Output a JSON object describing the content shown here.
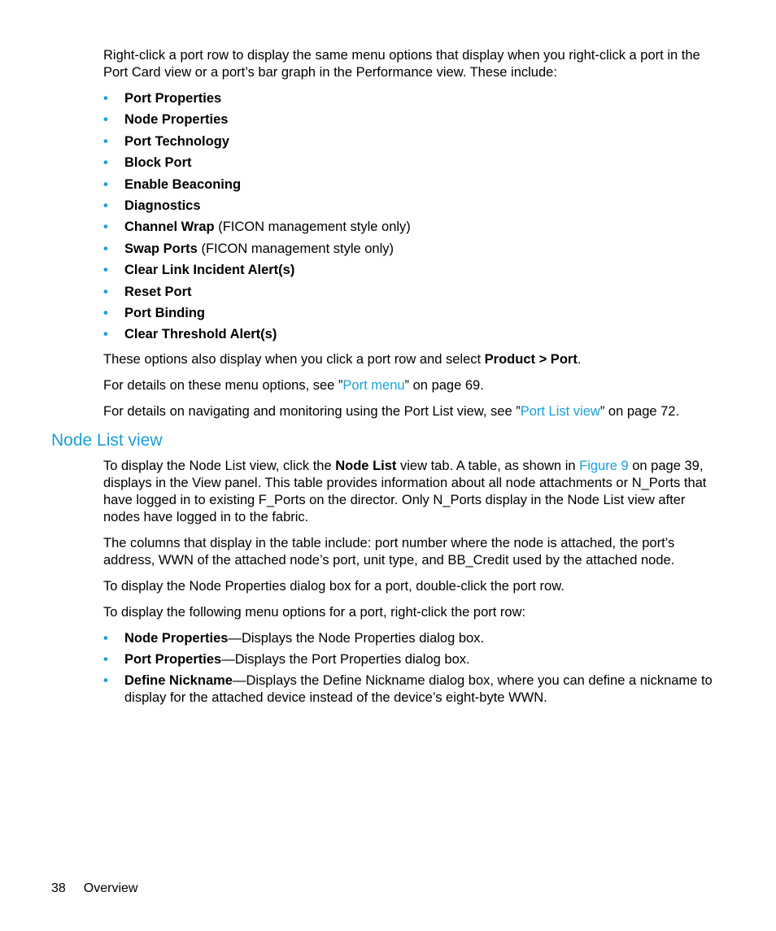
{
  "intro": "Right-click a port row to display the same menu options that display when you right-click a port in the Port Card view or a port’s bar graph in the Performance view. These include:",
  "port_menu_items": [
    {
      "bold": "Port Properties",
      "rest": ""
    },
    {
      "bold": "Node Properties",
      "rest": ""
    },
    {
      "bold": "Port Technology",
      "rest": ""
    },
    {
      "bold": "Block Port",
      "rest": ""
    },
    {
      "bold": "Enable Beaconing",
      "rest": ""
    },
    {
      "bold": "Diagnostics",
      "rest": ""
    },
    {
      "bold": "Channel Wrap",
      "rest": " (FICON management style only)"
    },
    {
      "bold": "Swap Ports",
      "rest": " (FICON management style only)"
    },
    {
      "bold": "Clear Link Incident Alert(s)",
      "rest": ""
    },
    {
      "bold": "Reset Port",
      "rest": ""
    },
    {
      "bold": "Port Binding",
      "rest": ""
    },
    {
      "bold": "Clear Threshold Alert(s)",
      "rest": ""
    }
  ],
  "also_display": {
    "pre": "These options also display when you click a port row and select ",
    "bold": "Product > Port",
    "post": "."
  },
  "details_menu": {
    "pre": "For details on these menu options, see ”",
    "link": "Port menu",
    "post": "” on page 69."
  },
  "details_portlist": {
    "pre": "For details on navigating and monitoring using the Port List view, see ”",
    "link": "Port List view",
    "post": "” on page 72."
  },
  "heading": "Node List view",
  "node_para1": {
    "pre": "To display the Node List view, click the ",
    "bold": "Node List",
    "mid": " view tab. A table, as shown in ",
    "link": "Figure 9",
    "post": " on page 39, displays in the View panel. This table provides information about all node attachments or N_Ports that have logged in to existing F_Ports on the director. Only N_Ports display in the Node List view after nodes have logged in to the fabric."
  },
  "node_para2": "The columns that display in the table include: port number where the node is attached, the port’s address, WWN of the attached node’s port, unit type, and BB_Credit used by the attached node.",
  "node_para3": "To display the Node Properties dialog box for a port, double-click the port row.",
  "node_para4": "To display the following menu options for a port, right-click the port row:",
  "node_menu_items": [
    {
      "bold": "Node Properties",
      "rest": "—Displays the Node Properties dialog box."
    },
    {
      "bold": "Port Properties",
      "rest": "—Displays the Port Properties dialog box."
    },
    {
      "bold": "Define Nickname",
      "rest": "—Displays the Define Nickname dialog box, where you can define a nickname to display for the attached device instead of the device’s eight-byte WWN."
    }
  ],
  "bullet_glyph": "•",
  "footer": {
    "page": "38",
    "section": "Overview"
  },
  "colors": {
    "accent": "#1a9fd9",
    "text": "#000000"
  }
}
